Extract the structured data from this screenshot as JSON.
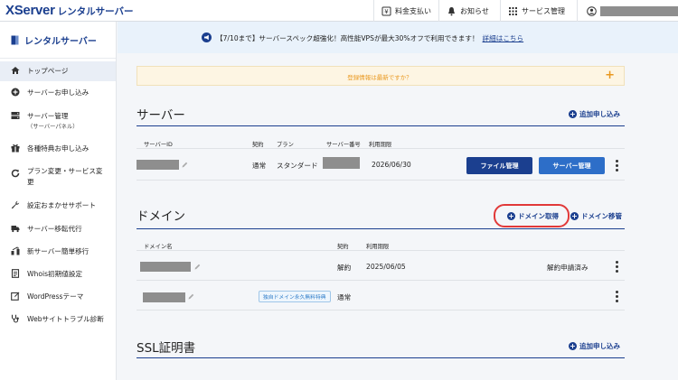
{
  "header": {
    "logo_main": "XServer",
    "logo_sub": "レンタルサーバー",
    "payment_label": "料金支払い",
    "notice_label": "お知らせ",
    "services_label": "サービス管理"
  },
  "sidebar": {
    "title": "レンタルサーバー",
    "items": [
      {
        "label": "トップページ",
        "icon": "home-icon"
      },
      {
        "label": "サーバーお申し込み",
        "icon": "plus-circle-icon"
      },
      {
        "label": "サーバー管理",
        "sub": "（サーバーパネル）",
        "icon": "server-icon"
      },
      {
        "label": "各種特典お申し込み",
        "icon": "gift-icon"
      },
      {
        "label": "プラン変更・サービス変",
        "label2": "更",
        "icon": "refresh-icon"
      },
      {
        "label": "設定おまかせサポート",
        "icon": "wrench-icon"
      },
      {
        "label": "サーバー移転代行",
        "icon": "truck-icon"
      },
      {
        "label": "新サーバー簡単移行",
        "icon": "transfer-icon"
      },
      {
        "label": "Whois初期値設定",
        "icon": "document-icon"
      },
      {
        "label": "WordPressテーマ",
        "icon": "edit-icon"
      },
      {
        "label": "Webサイトトラブル診断",
        "icon": "stethoscope-icon"
      }
    ]
  },
  "banner": {
    "text": "【7/10まで】サーバースペック超強化！高性能VPSが最大30%オフで利用できます！",
    "link": "詳細はこちら"
  },
  "notice": {
    "text": "登録情報は最新ですか？",
    "plus": "+"
  },
  "server_section": {
    "title": "サーバー",
    "add_label": "追加申し込み",
    "columns": [
      "サーバーID",
      "契約",
      "プラン",
      "サーバー番号",
      "利用期限"
    ],
    "row": {
      "contract": "通常",
      "plan": "スタンダード",
      "expiry": "2026/06/30",
      "file_btn": "ファイル管理",
      "panel_btn": "サーバー管理"
    }
  },
  "domain_section": {
    "title": "ドメイン",
    "acquire_label": "ドメイン取得",
    "transfer_label": "ドメイン移管",
    "columns": [
      "ドメイン名",
      "契約",
      "利用期限"
    ],
    "rows": [
      {
        "contract": "解約",
        "expiry": "2025/06/05",
        "status": "解約申請済み"
      },
      {
        "badge": "独自ドメイン永久無料特典",
        "contract": "通常"
      }
    ]
  },
  "ssl_section": {
    "title": "SSL証明書",
    "add_label": "追加申し込み"
  }
}
